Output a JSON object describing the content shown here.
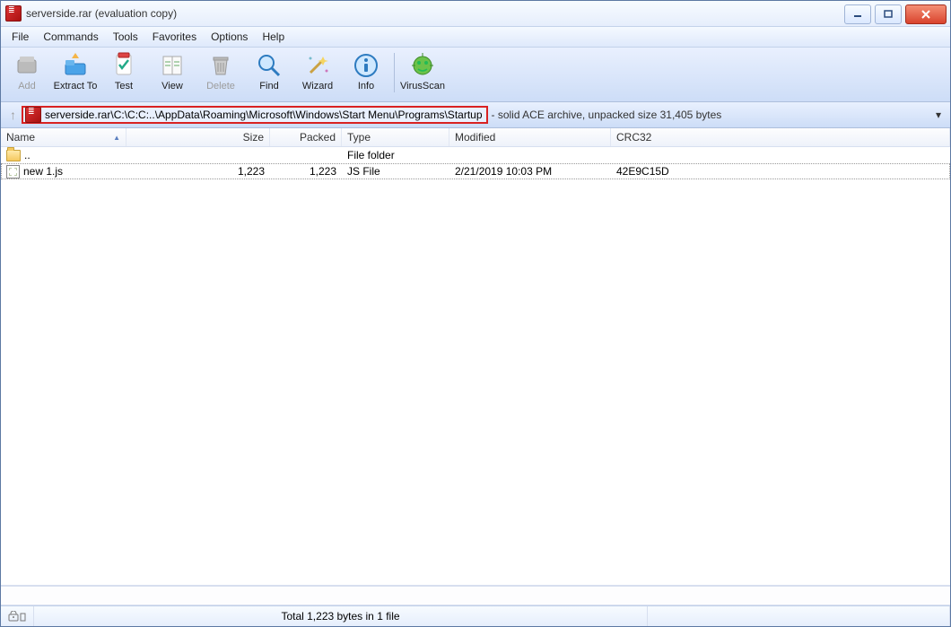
{
  "titlebar": {
    "title": "serverside.rar (evaluation copy)"
  },
  "menu": {
    "file": "File",
    "commands": "Commands",
    "tools": "Tools",
    "favorites": "Favorites",
    "options": "Options",
    "help": "Help"
  },
  "toolbar": {
    "add": "Add",
    "extract": "Extract To",
    "test": "Test",
    "view": "View",
    "delete": "Delete",
    "find": "Find",
    "wizard": "Wizard",
    "info": "Info",
    "virusscan": "VirusScan"
  },
  "pathbar": {
    "path": "serverside.rar\\C:\\C:C:..\\AppData\\Roaming\\Microsoft\\Windows\\Start Menu\\Programs\\Startup",
    "info": "- solid ACE archive, unpacked size 31,405 bytes"
  },
  "columns": {
    "name": "Name",
    "size": "Size",
    "packed": "Packed",
    "type": "Type",
    "modified": "Modified",
    "crc": "CRC32"
  },
  "rows": [
    {
      "icon": "folder",
      "name": "..",
      "size": "",
      "packed": "",
      "type": "File folder",
      "modified": "",
      "crc": ""
    },
    {
      "icon": "js",
      "name": "new 1.js",
      "size": "1,223",
      "packed": "1,223",
      "type": "JS File",
      "modified": "2/21/2019 10:03 PM",
      "crc": "42E9C15D"
    }
  ],
  "status": {
    "total": "Total 1,223 bytes in 1 file"
  }
}
